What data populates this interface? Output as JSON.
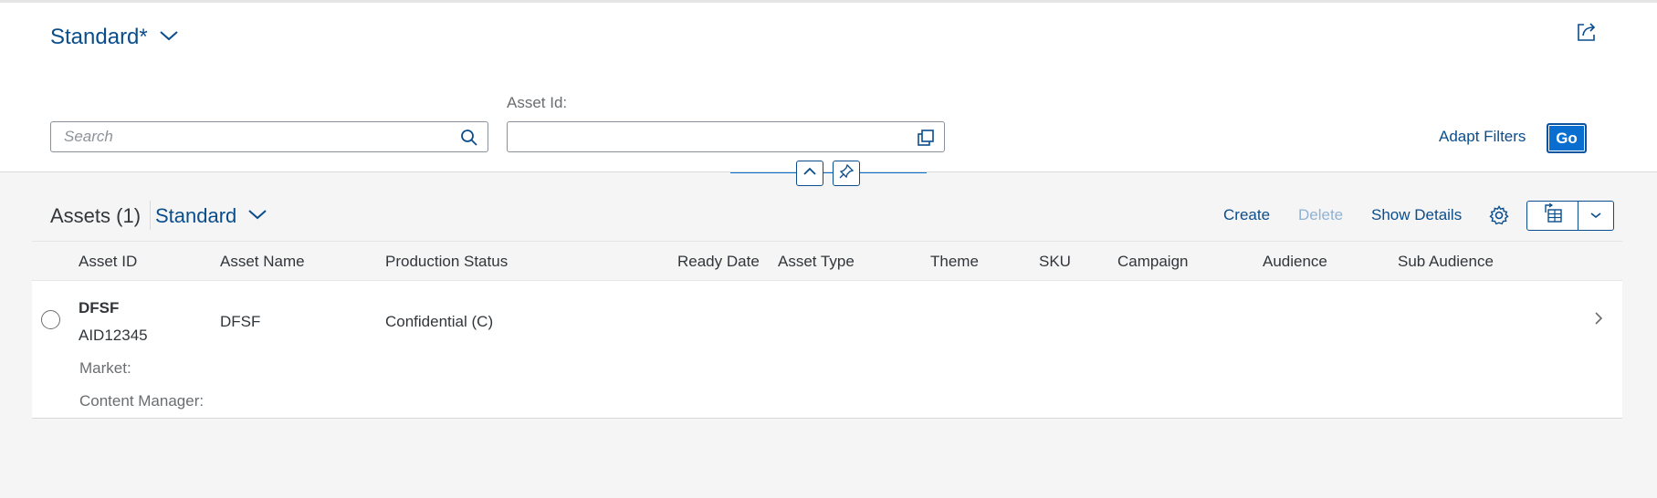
{
  "header": {
    "variant_title": "Standard*",
    "search": {
      "placeholder": "Search",
      "value": ""
    },
    "asset_id_filter": {
      "label": "Asset Id:",
      "value": ""
    },
    "adapt_filters_label": "Adapt Filters",
    "go_label": "Go"
  },
  "toolbar": {
    "title": "Assets (1)",
    "variant": "Standard",
    "create_label": "Create",
    "delete_label": "Delete",
    "show_details_label": "Show Details"
  },
  "table": {
    "columns": [
      "Asset ID",
      "Asset Name",
      "Production Status",
      "Ready Date",
      "Asset Type",
      "Theme",
      "SKU",
      "Campaign",
      "Audience",
      "Sub Audience"
    ],
    "rows": [
      {
        "asset_id_title": "DFSF",
        "asset_id": "AID12345",
        "asset_name": "DFSF",
        "production_status": "Confidential (C)",
        "details": [
          {
            "label": "Market:"
          },
          {
            "label": "Content Manager:"
          }
        ]
      }
    ]
  },
  "icons": {
    "variant_chevron": "chevron-down-icon",
    "share": "share-icon",
    "search": "search-icon",
    "value_help": "value-help-icon",
    "collapse": "chevron-up-icon",
    "pin": "pin-icon",
    "settings": "gear-icon",
    "export": "excel-export-icon",
    "row_nav": "chevron-right-icon"
  },
  "colors": {
    "brand": "#0a4d8c",
    "emphasized": "#0a6ed1",
    "disabled_link": "#8fb3d6"
  }
}
